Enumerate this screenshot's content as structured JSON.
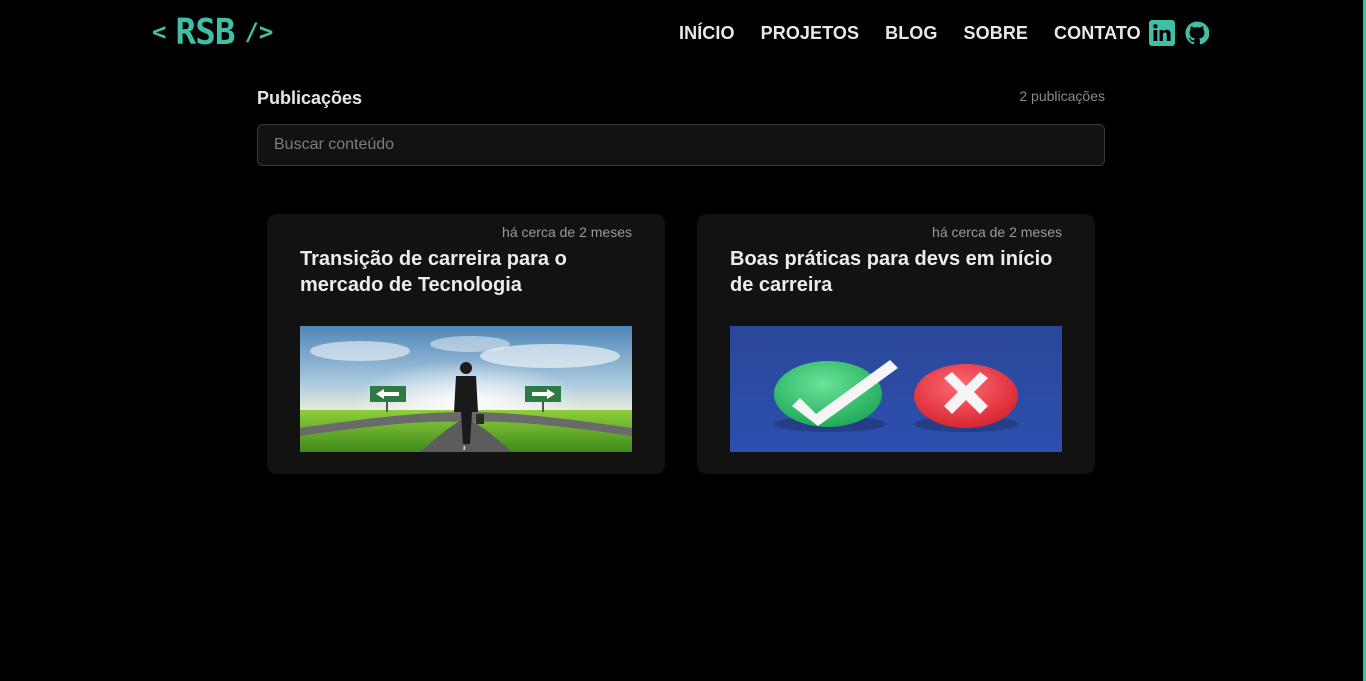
{
  "brand": {
    "open_bracket": "<",
    "name": "RSB",
    "close_bracket": "/>",
    "accent_color": "#3fbfa5"
  },
  "nav": {
    "items": [
      {
        "label": "INÍCIO"
      },
      {
        "label": "PROJETOS"
      },
      {
        "label": "BLOG"
      },
      {
        "label": "SOBRE"
      },
      {
        "label": "CONTATO"
      }
    ],
    "social": [
      {
        "icon": "linkedin-icon"
      },
      {
        "icon": "github-icon"
      }
    ]
  },
  "publications": {
    "title": "Publicações",
    "count": "2 publicações",
    "search_placeholder": "Buscar conteúdo",
    "posts": [
      {
        "date": "há cerca de 2 meses",
        "title": "Transição de carreira para o mercado de Tecnologia",
        "image": "career-crossroads-image"
      },
      {
        "date": "há cerca de 2 meses",
        "title": "Boas práticas para devs em início de carreira",
        "image": "check-and-cross-image"
      }
    ]
  },
  "colors": {
    "background": "#000000",
    "card_background": "#121212",
    "muted_text": "#8a8a8a"
  }
}
